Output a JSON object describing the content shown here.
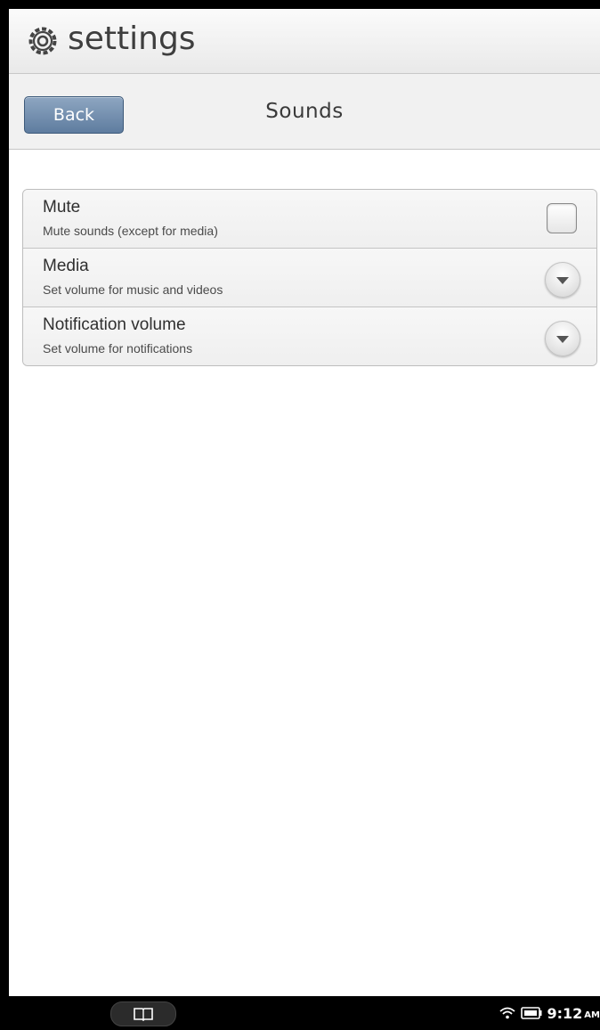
{
  "header": {
    "title": "settings",
    "icon": "gear-icon"
  },
  "subbar": {
    "back_label": "Back",
    "title": "Sounds",
    "back_color": "#6f8cad"
  },
  "settings": {
    "items": [
      {
        "title": "Mute",
        "description": "Mute sounds (except for media)",
        "control": "checkbox",
        "checked": false
      },
      {
        "title": "Media",
        "description": "Set volume for music and videos",
        "control": "dropdown"
      },
      {
        "title": "Notification volume",
        "description": "Set volume for notifications",
        "control": "dropdown"
      }
    ]
  },
  "status_bar": {
    "time": "9:12",
    "ampm": "AM",
    "icons": [
      "book-icon",
      "wifi-icon",
      "battery-icon"
    ]
  }
}
